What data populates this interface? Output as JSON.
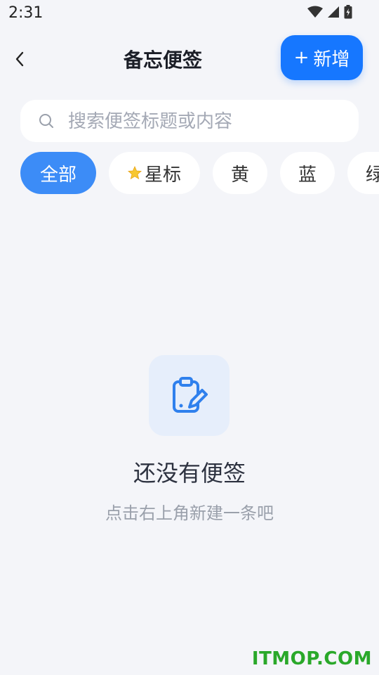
{
  "status_bar": {
    "time": "2:31"
  },
  "header": {
    "title": "备忘便签",
    "add_button_label": "新增"
  },
  "search": {
    "placeholder": "搜索便签标题或内容",
    "value": ""
  },
  "filters": [
    {
      "label": "全部",
      "active": true
    },
    {
      "label": "星标",
      "active": false,
      "icon": "star-icon"
    },
    {
      "label": "黄",
      "active": false
    },
    {
      "label": "蓝",
      "active": false
    },
    {
      "label": "绿",
      "active": false
    }
  ],
  "empty_state": {
    "icon": "clipboard-edit-icon",
    "title": "还没有便签",
    "subtitle": "点击右上角新建一条吧"
  },
  "watermark": "ITMOP.COM",
  "colors": {
    "accent": "#1677ff",
    "chip_active": "#3c8cf7",
    "background": "#f4f5f9",
    "watermark": "#2aa82a"
  }
}
